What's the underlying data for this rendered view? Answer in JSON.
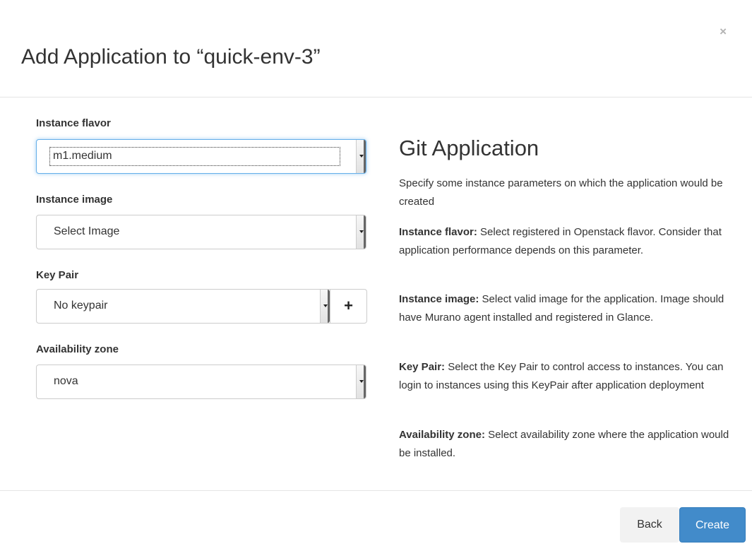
{
  "modal": {
    "title": "Add Application to “quick-env-3”",
    "close_label": "×"
  },
  "form": {
    "flavor": {
      "label": "Instance flavor",
      "value": "m1.medium"
    },
    "image": {
      "label": "Instance image",
      "value": "Select Image"
    },
    "keypair": {
      "label": "Key Pair",
      "value": "No keypair",
      "add_label": "+"
    },
    "zone": {
      "label": "Availability zone",
      "value": "nova"
    }
  },
  "help": {
    "title": "Git Application",
    "intro": "Specify some instance parameters on which the application would be created",
    "flavor_term": "Instance flavor:",
    "flavor_desc": " Select registered in Openstack flavor. Consider that application performance depends on this parameter.",
    "image_term": "Instance image:",
    "image_desc": " Select valid image for the application. Image should have Murano agent installed and registered in Glance.",
    "keypair_term": "Key Pair:",
    "keypair_desc": " Select the Key Pair to control access to instances. You can login to instances using this KeyPair after application deployment",
    "zone_term": "Availability zone:",
    "zone_desc": " Select availability zone where the application would be installed."
  },
  "footer": {
    "back_label": "Back",
    "create_label": "Create"
  },
  "colors": {
    "primary": "#428bca",
    "focus": "#66afe9"
  }
}
